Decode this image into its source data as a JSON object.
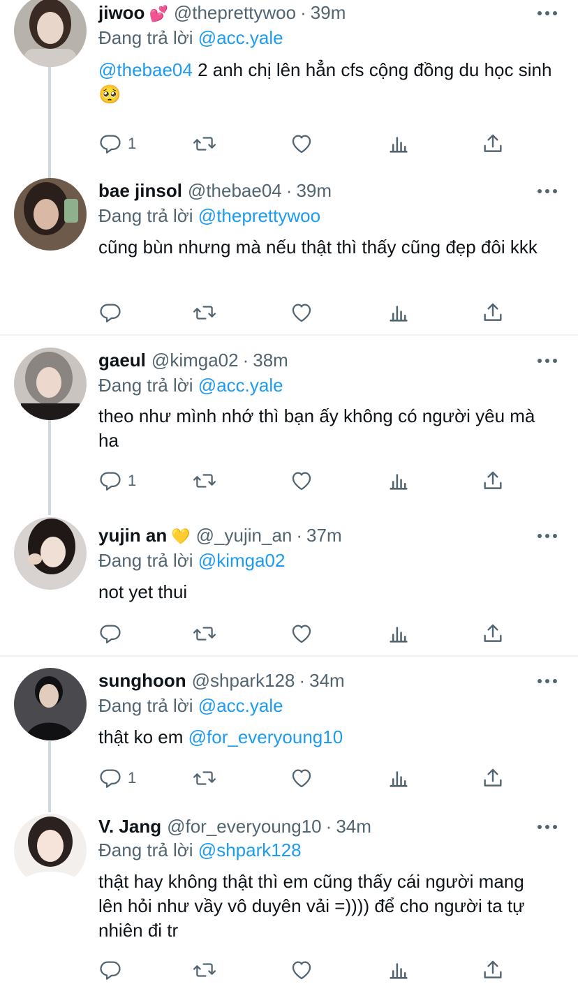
{
  "reply_prefix": "Đang trả lời",
  "tweets": [
    {
      "name": "jiwoo",
      "emoji": "💕",
      "handle": "@theprettywoo",
      "time": "39m",
      "reply_to": "@acc.yale",
      "text_mention": "@thebae04",
      "text": " 2 anh chị lên hẳn cfs cộng đồng du học sinh 🥺",
      "reply_count": "1",
      "avatar_colors": [
        "#b8b2ad",
        "#3a2a24",
        "#e9d6cb"
      ]
    },
    {
      "name": "bae jinsol",
      "emoji": "",
      "handle": "@thebae04",
      "time": "39m",
      "reply_to": "@theprettywoo",
      "text_mention": "",
      "text": "cũng bùn nhưng mà nếu thật thì thấy cũng đẹp đôi kkk",
      "reply_count": "",
      "avatar_colors": [
        "#6e5a4b",
        "#2a1f1a",
        "#d9b9a6"
      ]
    },
    {
      "name": "gaeul",
      "emoji": "",
      "handle": "@kimga02",
      "time": "38m",
      "reply_to": "@acc.yale",
      "text_mention": "",
      "text": "theo như mình nhớ thì bạn ấy không có người yêu mà ha",
      "reply_count": "1",
      "avatar_colors": [
        "#c9c4bf",
        "#8a8580",
        "#ecd8cc"
      ]
    },
    {
      "name": "yujin an",
      "emoji": "💛",
      "handle": "@_yujin_an",
      "time": "37m",
      "reply_to": "@kimga02",
      "text_mention": "",
      "text": "not yet thui",
      "reply_count": "",
      "avatar_colors": [
        "#d8d3d0",
        "#1f1816",
        "#f0dfd5"
      ]
    },
    {
      "name": "sunghoon",
      "emoji": "",
      "handle": "@shpark128",
      "time": "34m",
      "reply_to": "@acc.yale",
      "text_prefix": "thật ko em ",
      "text_mention": "@for_everyoung10",
      "text": "",
      "reply_count": "1",
      "avatar_colors": [
        "#4a4a4e",
        "#111114",
        "#e2ccbd"
      ]
    },
    {
      "name": "V. Jang",
      "emoji": "",
      "handle": "@for_everyoung10",
      "time": "34m",
      "reply_to": "@shpark128",
      "text_mention": "",
      "text": "thật hay không thật thì em cũng thấy cái người mang lên hỏi như vầy vô duyên vải =)))) để cho người ta tự nhiên đi tr",
      "reply_count": "",
      "avatar_colors": [
        "#f2efed",
        "#2b2220",
        "#f6e4db"
      ]
    }
  ],
  "icons": {
    "reply": "reply-icon",
    "retweet": "retweet-icon",
    "like": "heart-icon",
    "analytics": "analytics-icon",
    "share": "share-icon",
    "more": "more-icon"
  },
  "colors": {
    "link": "#1d9bf0",
    "secondary": "#536471",
    "thread_line": "#cfd9de",
    "divider": "#eff3f4"
  }
}
